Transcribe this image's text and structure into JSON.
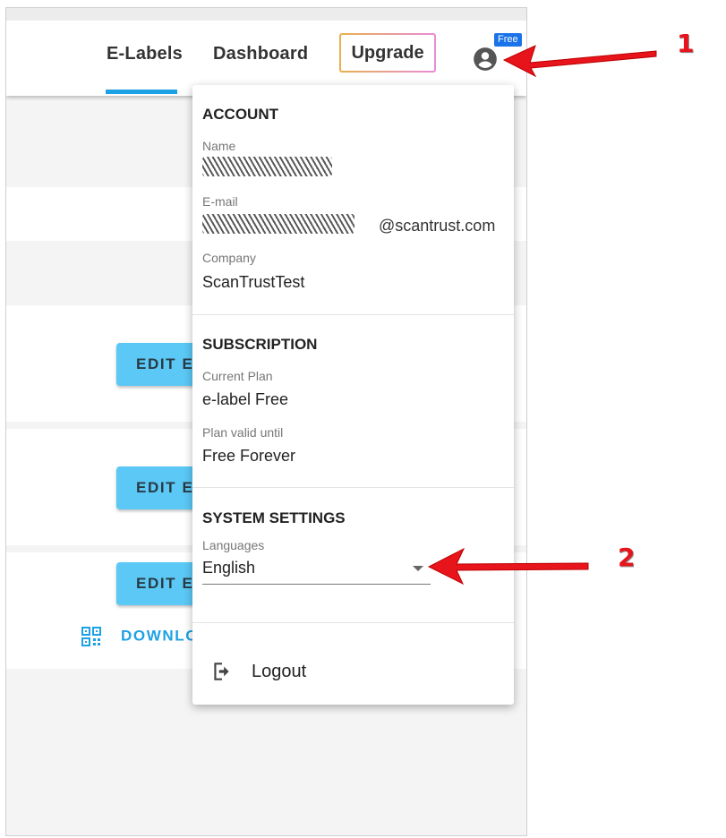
{
  "nav": {
    "elabels": "E-Labels",
    "dashboard": "Dashboard",
    "upgrade": "Upgrade",
    "free_badge": "Free",
    "avatar_icon": "account-circle-icon"
  },
  "background": {
    "edit_button_label": "EDIT E-",
    "download_label": "DOWNLO",
    "download_icon": "qr-code-icon"
  },
  "account": {
    "title": "ACCOUNT",
    "name_label": "Name",
    "email_label": "E-mail",
    "email_domain": "@scantrust.com",
    "company_label": "Company",
    "company_value": "ScanTrustTest"
  },
  "subscription": {
    "title": "SUBSCRIPTION",
    "plan_label": "Current Plan",
    "plan_value": "e-label Free",
    "valid_label": "Plan valid until",
    "valid_value": "Free Forever"
  },
  "system": {
    "title": "SYSTEM SETTINGS",
    "languages_label": "Languages",
    "language_value": "English"
  },
  "logout": {
    "label": "Logout",
    "icon": "logout-icon"
  },
  "annotations": {
    "marker_1": "1",
    "marker_2": "2"
  },
  "colors": {
    "accent": "#1da1e6",
    "button": "#5bc8f5",
    "badge": "#1a73e8",
    "annotation": "#e8141c"
  }
}
